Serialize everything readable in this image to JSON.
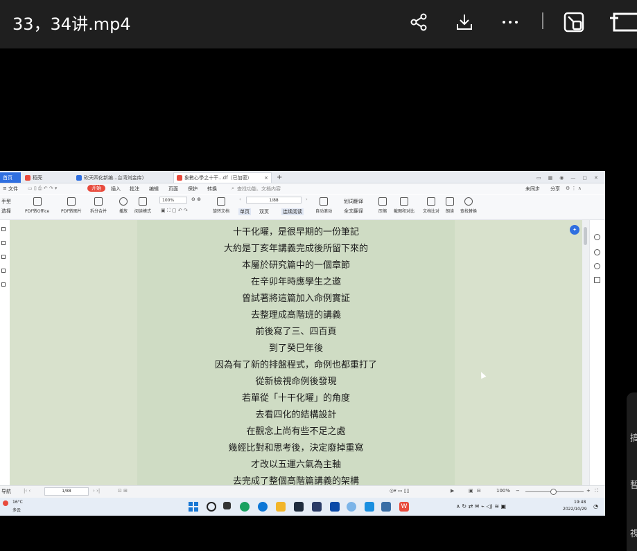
{
  "player": {
    "title": "33，34讲.mp4",
    "share_icon": "share-icon",
    "download_icon": "download-icon",
    "more_icon": "more-icon",
    "pip_icon": "picture-in-picture-icon",
    "resize_icon": "window-icon"
  },
  "browser_tabs": [
    {
      "label": "首页",
      "icon": ""
    },
    {
      "label": "稻壳",
      "icon": "docer-icon"
    },
    {
      "label": "砍天四化新编...台湾刘金库)",
      "icon": "pdf-icon"
    },
    {
      "label": "象數心學之十干...df（已加密）",
      "icon": "pdf-icon"
    },
    {
      "label": "+",
      "icon": "new-tab-icon"
    }
  ],
  "menu": {
    "items": [
      "文件",
      "开始",
      "插入",
      "批注",
      "编辑",
      "页面",
      "保护",
      "转换"
    ],
    "search_placeholder": "查找功能、文档内容",
    "right_items": [
      "未同步",
      "分享"
    ]
  },
  "toolbar": {
    "left": [
      "手型",
      "选择"
    ],
    "tools": [
      "PDF转Office",
      "PDF转图片",
      "拆分合并",
      "播放",
      "阅读模式"
    ],
    "zoom": "100%",
    "page": "1/88",
    "page_tools": [
      "旋转文档",
      "单页",
      "双页",
      "连续阅读",
      "自动滚动",
      "划词翻译",
      "全文翻译",
      "压缩",
      "截图和对比",
      "文档比对",
      "朗读",
      "查找替换"
    ]
  },
  "document": {
    "lines": [
      "十干化曜，是很早期的一份筆記",
      "大約是丁亥年講義完成後所留下來的",
      "本屬於研究篇中的一個章節",
      "在辛卯年時應學生之邀",
      "曾試著將這篇加入命例實証",
      "去整理成高階班的講義",
      "前後寫了三、四百頁",
      "到了癸巳年後",
      "因為有了新的排盤程式，命例也都重打了",
      "從新檢視命例後發現",
      "若單從「十干化曜」的角度",
      "去看四化的結構設計",
      "在觀念上尚有些不足之處",
      "幾經比對和思考後，決定廢掉重寫",
      "才改以五運六氣為主軸",
      "去完成了整個高階篇講義的架構"
    ]
  },
  "statusbar": {
    "nav": "导航",
    "page": "1/88",
    "zoom": "100%"
  },
  "taskbar": {
    "weather_temp": "16°C",
    "weather_desc": "多云",
    "time": "19:48",
    "date": "2022/10/29"
  },
  "side_panel": {
    "chars": [
      "搞",
      "暫",
      "視"
    ]
  }
}
